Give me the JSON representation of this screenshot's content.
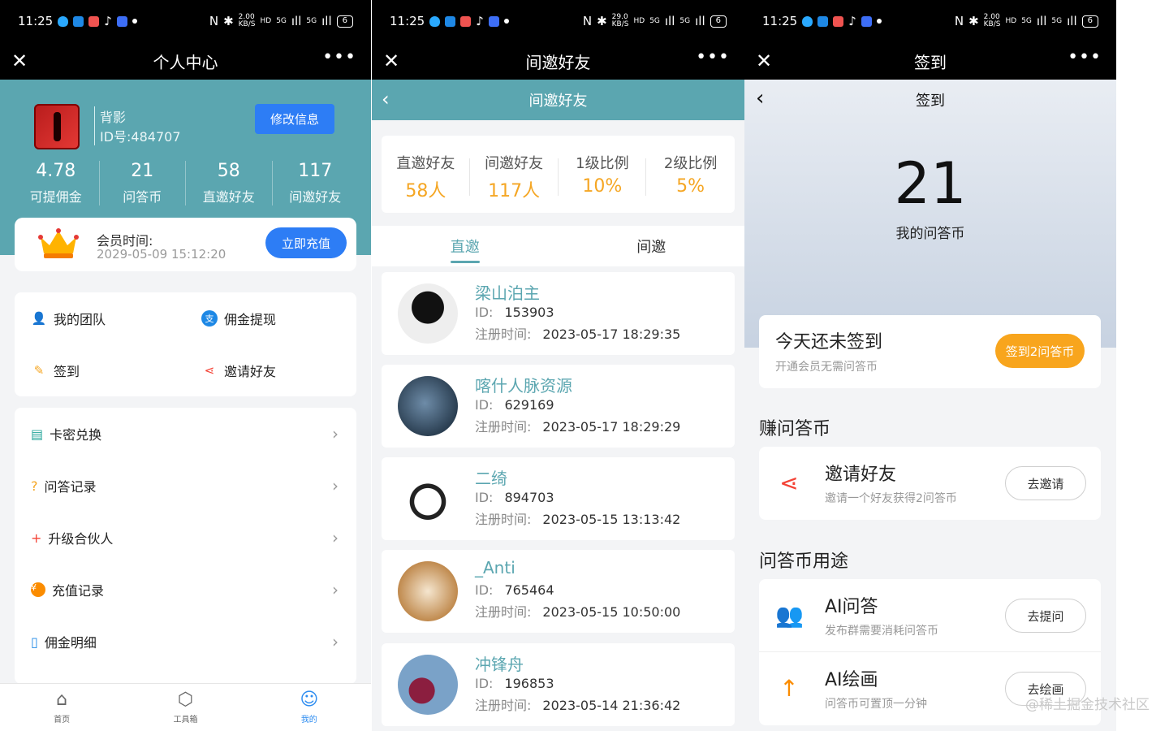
{
  "status_bar": {
    "time": "11:25",
    "speed_p1": "2.00",
    "speed_p2": "29.0",
    "speed_p3": "2.00",
    "speed_unit": "KB/S",
    "hd": "HD",
    "net1": "5G",
    "net2": "5G",
    "battery": "6"
  },
  "panel1": {
    "title": "个人中心",
    "user": {
      "name": "背影",
      "id": "ID号:484707"
    },
    "edit_label": "修改信息",
    "stats": [
      {
        "value": "4.78",
        "label": "可提佣金"
      },
      {
        "value": "21",
        "label": "问答币"
      },
      {
        "value": "58",
        "label": "直邀好友"
      },
      {
        "value": "117",
        "label": "间邀好友"
      }
    ],
    "vip": {
      "label": "会员时间:",
      "time": "2029-05-09 15:12:20",
      "button": "立即充值"
    },
    "grid": [
      "我的团队",
      "佣金提现",
      "签到",
      "邀请好友"
    ],
    "list": [
      "卡密兑换",
      "问答记录",
      "升级合伙人",
      "充值记录",
      "佣金明细"
    ],
    "tabs": [
      "首页",
      "工具箱",
      "我的"
    ]
  },
  "panel2": {
    "title": "间邀好友",
    "header": "间邀好友",
    "stats": [
      {
        "label": "直邀好友",
        "value": "58人"
      },
      {
        "label": "间邀好友",
        "value": "117人"
      },
      {
        "label": "1级比例",
        "value": "10%"
      },
      {
        "label": "2级比例",
        "value": "5%"
      }
    ],
    "tabs": [
      "直邀",
      "间邀"
    ],
    "id_label": "ID:",
    "time_label": "注册时间:",
    "friends": [
      {
        "name": "梁山泊主",
        "id": "153903",
        "time": "2023-05-17 18:29:35"
      },
      {
        "name": "喀什人脉资源",
        "id": "629169",
        "time": "2023-05-17 18:29:29"
      },
      {
        "name": "二绮",
        "id": "894703",
        "time": "2023-05-15 13:13:42"
      },
      {
        "name": "_Anti",
        "id": "765464",
        "time": "2023-05-15 10:50:00"
      },
      {
        "name": "冲锋舟",
        "id": "196853",
        "time": "2023-05-14 21:36:42"
      }
    ]
  },
  "panel3": {
    "title": "签到",
    "header": "签到",
    "coins": "21",
    "coins_label": "我的问答币",
    "sign": {
      "title": "今天还未签到",
      "sub": "开通会员无需问答币",
      "button": "签到2问答币"
    },
    "earn_title": "赚问答币",
    "earn": [
      {
        "title": "邀请好友",
        "sub": "邀请一个好友获得2问答币",
        "button": "去邀请"
      }
    ],
    "use_title": "问答币用途",
    "uses": [
      {
        "title": "AI问答",
        "sub": "发布群需要消耗问答币",
        "button": "去提问"
      },
      {
        "title": "AI绘画",
        "sub": "问答币可置顶一分钟",
        "button": "去绘画"
      }
    ]
  },
  "watermark": "@稀土掘金技术社区",
  "colors": {
    "teal": "#5ba6b0",
    "blue": "#2d7df5",
    "orange": "#f8a51d",
    "gold": "#f5a623"
  }
}
